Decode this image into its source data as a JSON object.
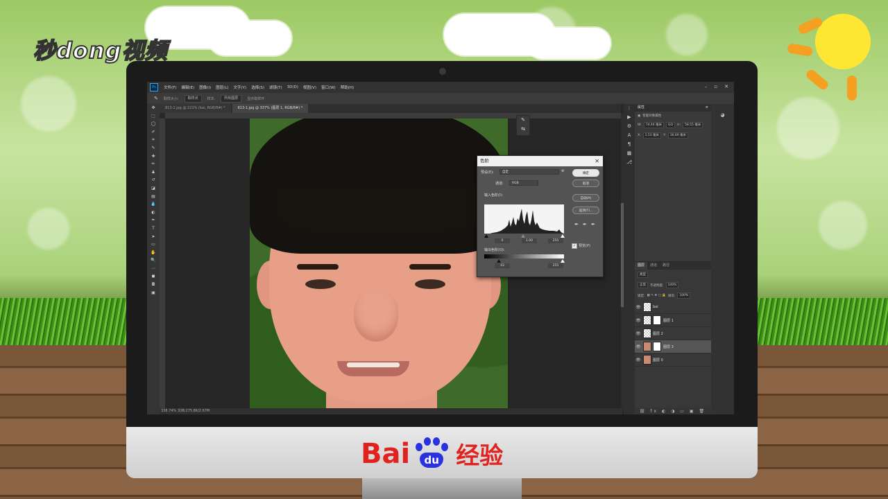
{
  "overlay": {
    "brand_logo": "秒dong视频",
    "baidu_prefix": "Bai",
    "baidu_paw": "du",
    "baidu_suffix": "经验"
  },
  "photoshop": {
    "app_icon": "Ps",
    "menu": [
      "文件(F)",
      "编辑(E)",
      "图像(I)",
      "图层(L)",
      "文字(Y)",
      "选择(S)",
      "滤镜(T)",
      "3D(D)",
      "视图(V)",
      "窗口(W)",
      "帮助(H)"
    ],
    "window_controls": [
      "–",
      "▫",
      "✕"
    ],
    "options_bar": {
      "tool_label": "取样大小:",
      "sample_size": "取样点",
      "sample_label": "样本:",
      "sample_value": "所有图层",
      "ring_label": "显示取样环"
    },
    "tabs": [
      {
        "label": "813-2.jpg @ 223% (bai, RGB/8#) *",
        "active": false
      },
      {
        "label": "813-1.jpg @ 337% (图层 1, RGB/8#) *",
        "active": true
      }
    ],
    "status": "336.74%      文档:275.8K/2.67M",
    "properties_panel": {
      "title": "属性",
      "subtitle": "智能对象属性",
      "w": "74.44 毫米",
      "h": "58.55 毫米",
      "link_tag": "GO",
      "x": "1.53 毫米",
      "y": "36.69 毫米",
      "x_prefix": "X:",
      "y_prefix": "Y:",
      "w_prefix": "W:",
      "h_prefix": "H:"
    },
    "layers_panel": {
      "tabs": [
        "图层",
        "通道",
        "路径"
      ],
      "kind_label": "类型",
      "blend_mode": "正常",
      "opacity_label": "不透明度:",
      "opacity_value": "100%",
      "lock_label": "锁定:",
      "fill_label": "填充:",
      "fill_value": "100%",
      "layers": [
        {
          "name": "bai",
          "has_mask": false,
          "selected": false,
          "photo": false
        },
        {
          "name": "图层 1",
          "has_mask": true,
          "selected": false,
          "photo": false
        },
        {
          "name": "图层 2",
          "has_mask": false,
          "selected": false,
          "photo": false
        },
        {
          "name": "图层 3",
          "has_mask": true,
          "selected": true,
          "photo": true
        },
        {
          "name": "图层 0",
          "has_mask": false,
          "selected": false,
          "photo": true
        }
      ],
      "footer_icons": "⛓ fx ◐ ◑ ▭ ▣ 🗑"
    },
    "levels_dialog": {
      "title": "色阶",
      "preset_label": "预设(E):",
      "preset_value": "自定",
      "channel_label": "通道:",
      "channel_value": "RGB",
      "input_label": "输入色阶(I):",
      "input_black": "0",
      "input_gamma": "1.00",
      "input_white": "255",
      "output_label": "输出色阶(O):",
      "output_black": "43",
      "output_white": "255",
      "buttons": {
        "ok": "确定",
        "cancel": "取消",
        "auto": "自动(A)",
        "options": "选项(T)..."
      },
      "preview_label": "预览(P)",
      "preview_checked": true
    }
  }
}
